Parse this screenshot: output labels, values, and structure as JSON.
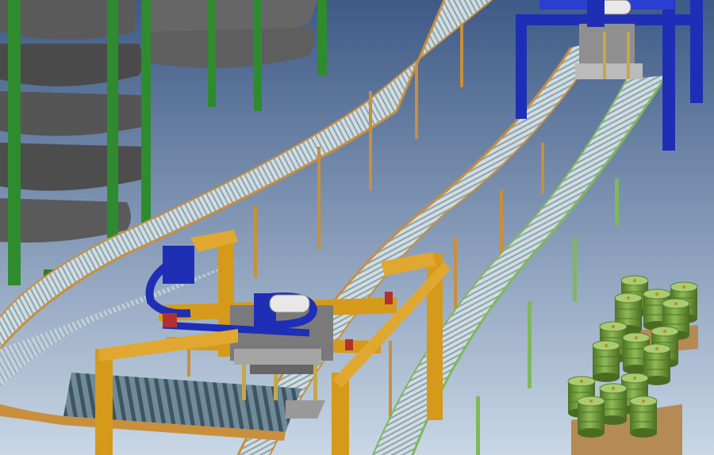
{
  "scene": {
    "description_kind": "3d-render",
    "colors": {
      "sky_top": "#3e5a86",
      "sky_bottom": "#c3d3e4",
      "tower_steel": "#4a4a4a",
      "tower_column": "#2e8b2e",
      "conveyor_rollers": "#b9c9cf",
      "conveyor_rail": "#c98f3c",
      "leg_post": "#c98f3c",
      "gantry_orange": "#d59a1a",
      "gantry_blue": "#1f2fb5",
      "press_plate": "#9a9a9a",
      "green_rail": "#7fb85a",
      "drum_green": "#6f9a3a",
      "pallet_wood": "#b58a55"
    },
    "objects": [
      "spiral-conveyor-tower",
      "upper-roller-conveyor",
      "middle-roller-conveyor",
      "right-roller-conveyor",
      "lower-pallet-conveyor",
      "orange-gantry-press",
      "blue-gantry-press",
      "drum-pallet-stack"
    ]
  }
}
